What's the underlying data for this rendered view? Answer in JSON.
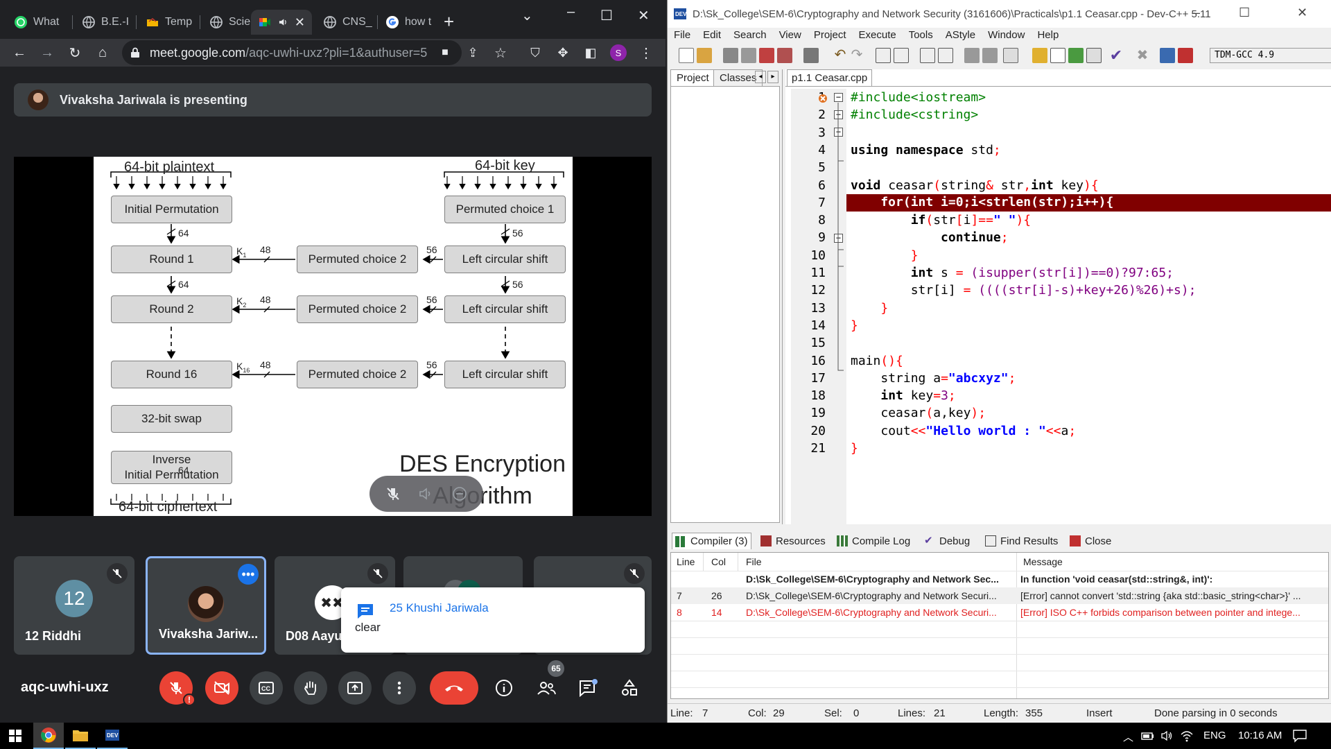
{
  "browser": {
    "tabs": [
      {
        "label": "What",
        "icon": "whatsapp-icon"
      },
      {
        "label": "B.E.-I",
        "icon": "globe-icon"
      },
      {
        "label": "Temp",
        "icon": "folder-icon"
      },
      {
        "label": "Scien",
        "icon": "globe-icon"
      },
      {
        "label": "",
        "icon": "meet-icon"
      },
      {
        "label": "CNS_",
        "icon": "globe-icon"
      },
      {
        "label": "how t",
        "icon": "google-icon"
      }
    ],
    "url_host": "meet.google.com",
    "url_path": "/aqc-uwhi-uxz?pli=1&authuser=5",
    "profile_initial": "S"
  },
  "meet": {
    "presenting_text": "Vivaksha Jariwala is presenting",
    "slide": {
      "plaintext_label": "64-bit plaintext",
      "key_label": "64-bit key",
      "ciphertext_label": "64-bit ciphertext",
      "initial_permutation": "Initial Permutation",
      "permuted_choice_1": "Permuted choice 1",
      "round1": "Round 1",
      "round2": "Round 2",
      "round16": "Round 16",
      "permuted_choice_2": "Permuted choice 2",
      "left_circular_shift": "Left circular shift",
      "swap": "32-bit swap",
      "inverse_line1": "Inverse",
      "inverse_line2": "Initial Permutation",
      "bits64": "64",
      "bits56": "56",
      "bits48": "48",
      "k": "K",
      "k1": "1",
      "k2": "2",
      "k16": "16",
      "caption_line1": "DES Encryption",
      "caption_line2": "Algorithm"
    },
    "tiles": [
      {
        "initials": "12",
        "name": "12 Riddhi",
        "avatar_color": "#5f8fa3"
      },
      {
        "name": "Vivaksha Jariw..."
      },
      {
        "name": "D08 Aayus"
      },
      {
        "name": ""
      },
      {
        "name": ""
      }
    ],
    "chat_toast": {
      "sender": "25 Khushi Jariwala",
      "message": "clear"
    },
    "meeting_code": "aqc-uwhi-uxz",
    "participants_count": "65"
  },
  "devcpp": {
    "title": "D:\\Sk_College\\SEM-6\\Cryptography and Network Security (3161606)\\Practicals\\p1.1 Ceasar.cpp - Dev-C++ 5.11",
    "menu": [
      "File",
      "Edit",
      "Search",
      "View",
      "Project",
      "Execute",
      "Tools",
      "AStyle",
      "Window",
      "Help"
    ],
    "compiler_select": "TDM-GCC 4.9",
    "left_tabs": [
      "Project",
      "Classes"
    ],
    "file_tab": "p1.1 Ceasar.cpp",
    "line_numbers": [
      "1",
      "2",
      "3",
      "4",
      "5",
      "6",
      "7",
      "8",
      "9",
      "10",
      "11",
      "12",
      "13",
      "14",
      "15",
      "16",
      "17",
      "18",
      "19",
      "20",
      "21"
    ],
    "code": {
      "l1": "#include<iostream>",
      "l2": "#include<cstring>",
      "l4_kw": "using namespace",
      "l4_rest": " std",
      "l6_kw": "void",
      "l6_a": " ceasar",
      "l6_b": "string",
      "l6_c": " str",
      "l6_kw2": "int",
      "l6_d": " key",
      "l7": "    for(int i=0;i<strlen(str);i++){",
      "l8_kw": "if",
      "l8_a": "str",
      "l8_b": "i",
      "l8_str": "\" \"",
      "l9": "continue",
      "l11_kw": "int",
      "l11_a": " s ",
      "l11_b": " (isupper(str[i])==0)?97:65;",
      "l12_a": "str[i] ",
      "l12_b": " ((((str[i]-s)+key+26)%26)+s);",
      "l16": "main",
      "l17_a": "string a",
      "l17_str": "\"abcxyz\"",
      "l18_kw": "int",
      "l18_a": " key",
      "l18_num": "3",
      "l19_a": "ceasar",
      "l19_b": "a,key",
      "l20_a": "cout",
      "l20_str": "\"Hello world : \"",
      "l20_b": "a"
    },
    "bottom_tabs": [
      "Compiler (3)",
      "Resources",
      "Compile Log",
      "Debug",
      "Find Results",
      "Close"
    ],
    "grid_headers": {
      "line": "Line",
      "col": "Col",
      "file": "File",
      "message": "Message"
    },
    "messages": [
      {
        "line": "",
        "col": "",
        "file": "D:\\Sk_College\\SEM-6\\Cryptography and Network Sec...",
        "message": "In function 'void ceasar(std::string&, int)':"
      },
      {
        "line": "7",
        "col": "26",
        "file": "D:\\Sk_College\\SEM-6\\Cryptography and Network Securi...",
        "message": "[Error] cannot convert 'std::string {aka std::basic_string<char>}' ..."
      },
      {
        "line": "8",
        "col": "14",
        "file": "D:\\Sk_College\\SEM-6\\Cryptography and Network Securi...",
        "message": "[Error] ISO C++ forbids comparison between pointer and intege..."
      }
    ],
    "status": {
      "line_label": "Line:",
      "line": "7",
      "col_label": "Col:",
      "col": "29",
      "sel_label": "Sel:",
      "sel": "0",
      "lines_label": "Lines:",
      "lines": "21",
      "length_label": "Length:",
      "length": "355",
      "mode": "Insert",
      "parse": "Done parsing in 0 seconds"
    }
  },
  "taskbar": {
    "lang": "ENG",
    "time": "10:16 AM"
  }
}
